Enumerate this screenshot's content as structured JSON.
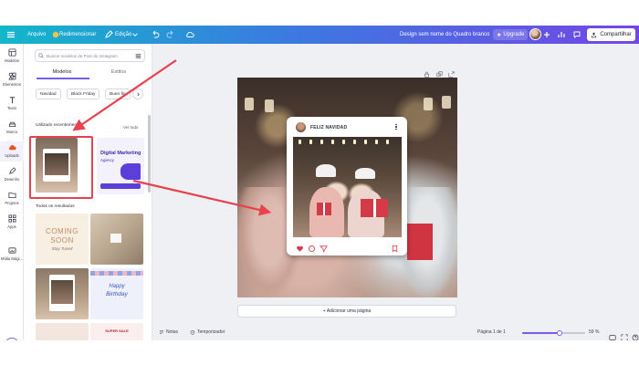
{
  "topbar": {
    "menu_label": "Arquivo",
    "resize_label": "Redimensionar",
    "edit_label": "Edição",
    "design_title": "Design sem nome do Quadro branco",
    "upgrade_label": "Upgrade",
    "share_label": "Compartilhar"
  },
  "rail": {
    "items": [
      {
        "label": "Modelos",
        "icon": "layout-icon"
      },
      {
        "label": "Elementos",
        "icon": "shapes-icon"
      },
      {
        "label": "Texto",
        "icon": "text-icon"
      },
      {
        "label": "Marca",
        "icon": "brand-icon"
      },
      {
        "label": "Uploads",
        "icon": "upload-cloud-icon",
        "active": true
      },
      {
        "label": "Desenho",
        "icon": "pen-icon"
      },
      {
        "label": "Projetos",
        "icon": "folder-icon"
      },
      {
        "label": "Apps",
        "icon": "apps-icon"
      },
      {
        "label": "Mídia Mági...",
        "icon": "magic-media-icon"
      }
    ]
  },
  "panel": {
    "search_placeholder": "Buscar modelos de Post do Instagram",
    "tabs": [
      {
        "label": "Modelos",
        "active": true
      },
      {
        "label": "Estilos",
        "active": false
      }
    ],
    "chips": [
      "Navidad",
      "Black Friday",
      "Buen fin"
    ],
    "recent_heading": "Utilizado recentemente",
    "see_all": "Ver tudo",
    "results_heading": "Todos os resultados",
    "thumbs": {
      "marketing_title": "Digital Marketing",
      "marketing_sub": "Agency",
      "coming_soon_1": "COMING",
      "coming_soon_2": "SOON",
      "coming_soon_3": "Stay Tuned",
      "birthday_1": "Happy",
      "birthday_2": "Birthday",
      "sale_text": "SUPER SALE"
    }
  },
  "canvas": {
    "profile_name": "FELIZ NAVIDAD",
    "add_page_label": "+ Adicionar uma página"
  },
  "bottombar": {
    "notes_label": "Notas",
    "timer_label": "Temporizador",
    "page_label": "Página 1 de 1",
    "zoom_label": "59 %",
    "zoom_value": 0.59
  },
  "colors": {
    "accent": "#7a5df0",
    "annotation": "#e8424f",
    "uploads_icon": "#e1561c"
  }
}
